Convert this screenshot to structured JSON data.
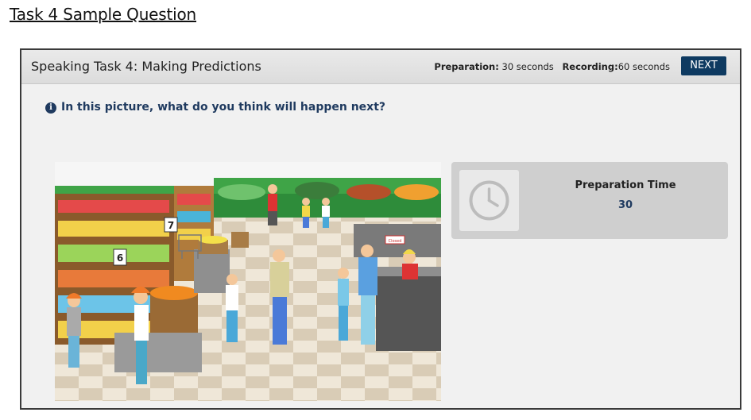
{
  "page": {
    "heading": "Task 4 Sample Question"
  },
  "window": {
    "task_title": "Speaking Task 4: Making Predictions",
    "timing": {
      "preparation_label": "Preparation:",
      "preparation_value": "30 seconds",
      "recording_label": "Recording:",
      "recording_value": "60 seconds"
    },
    "next_label": "NEXT"
  },
  "question": {
    "text": "In this picture, what do you think will happen next?",
    "icon": "info-icon"
  },
  "scene": {
    "aisle_sign_7": "7",
    "aisle_sign_6": "6",
    "closed_sign": "Closed"
  },
  "prep_panel": {
    "label": "Preparation Time",
    "value": "30",
    "icon": "clock-icon"
  },
  "colors": {
    "next_button": "#0e3a61",
    "question_text": "#1f3a5f",
    "panel_bg": "#cfcfcf",
    "window_bg": "#f1f1f1"
  }
}
